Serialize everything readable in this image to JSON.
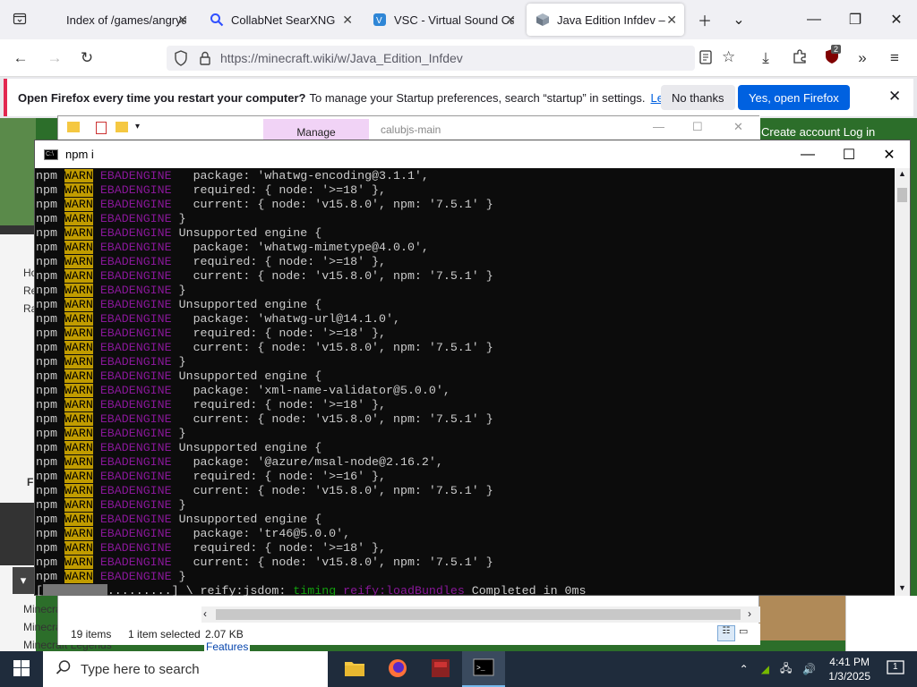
{
  "browser": {
    "tabs": [
      {
        "title": "Index of /games/angryauth",
        "active": false
      },
      {
        "title": "CollabNet SearXNG",
        "active": false
      },
      {
        "title": "VSC - Virtual Sound Card",
        "active": false
      },
      {
        "title": "Java Edition Infdev – Minecraft",
        "active": true
      }
    ],
    "url": "https://minecraft.wiki/w/Java_Edition_Infdev",
    "extension_badge": "2"
  },
  "notification": {
    "bold_text": "Open Firefox every time you restart your computer?",
    "text": "To manage your Startup preferences, search “startup” in settings.",
    "link": "Learn more",
    "no_button": "No thanks",
    "yes_button": "Yes, open Firefox"
  },
  "website": {
    "account_links": "Create account  Log in",
    "sidebar_letters": [
      "Ho",
      "Re",
      "Ra",
      "F"
    ],
    "bottom_links": [
      "Minecra",
      "Minecra",
      "Minecraft Legends"
    ],
    "features_link": "Features"
  },
  "explorer": {
    "manage_tab": "Manage",
    "folder_title": "calubjs-main",
    "items_count": "19 items",
    "selected": "1 item selected",
    "size": "2.07 KB"
  },
  "terminal": {
    "title": "npm i",
    "blocks": [
      {
        "package": "whatwg-encoding@3.1.1",
        "required": ">=18"
      },
      {
        "package": "whatwg-mimetype@4.0.0",
        "required": ">=18"
      },
      {
        "package": "whatwg-url@14.1.0",
        "required": ">=18"
      },
      {
        "package": "xml-name-validator@5.0.0",
        "required": ">=18"
      },
      {
        "package": "@azure/msal-node@2.16.2",
        "required": ">=16"
      },
      {
        "package": "tr46@5.0.0",
        "required": ">=18"
      }
    ],
    "current": "{ node: 'v15.8.0', npm: '7.5.1' }",
    "npm_label": "npm",
    "warn_label": "WARN",
    "eb_label": "EBADENGINE",
    "unsupported": "Unsupported engine {",
    "progress_line": {
      "prefix": "[",
      "dots": ".........",
      "middle": "] \\ reify:jsdom: ",
      "timing": "timing",
      "reify": "reify:loadBundles",
      "suffix": " Completed in 0ms"
    }
  },
  "taskbar": {
    "search_placeholder": "Type here to search",
    "time": "4:41 PM",
    "date": "1/3/2025",
    "notification_count": "1"
  }
}
